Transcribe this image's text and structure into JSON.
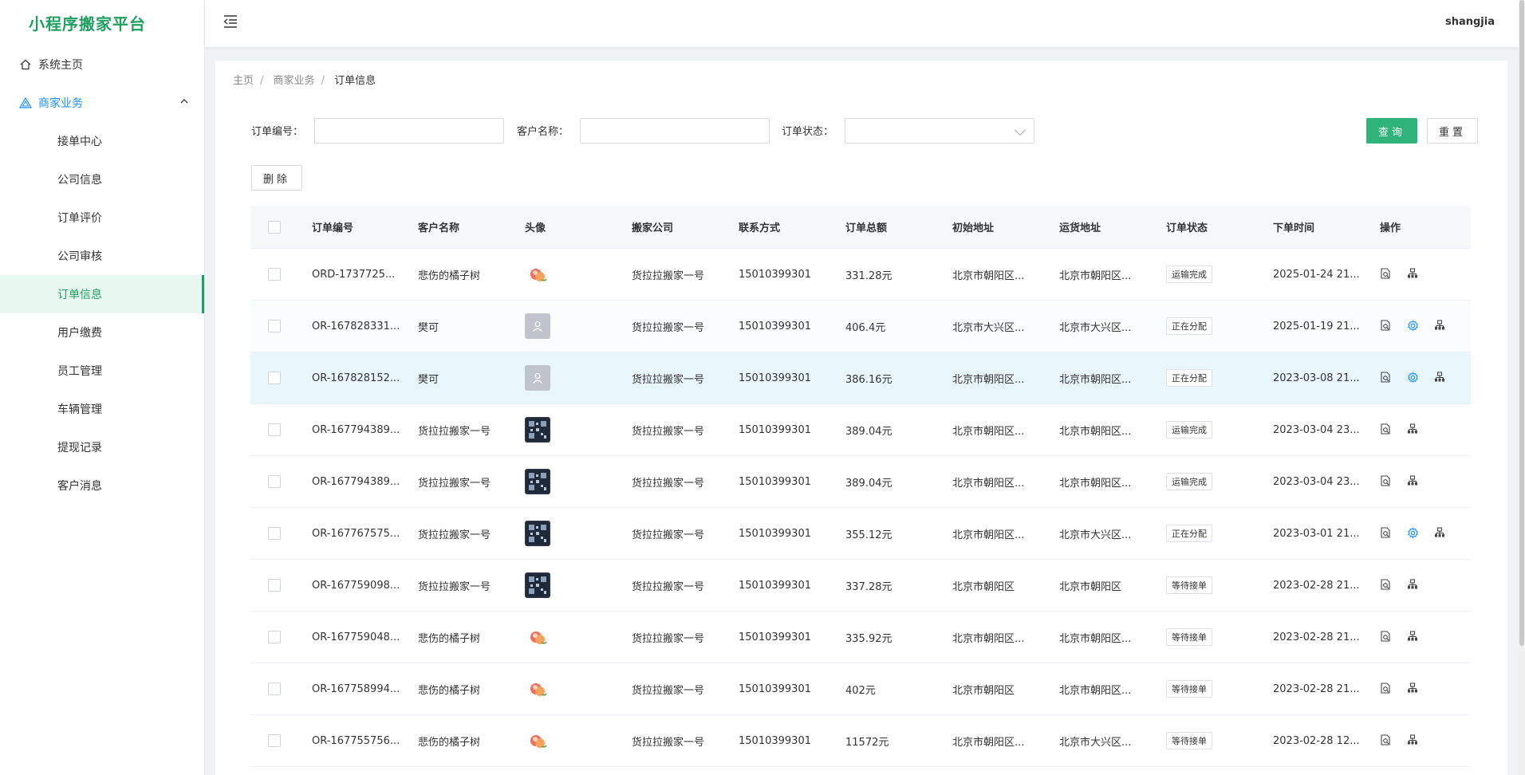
{
  "app": {
    "title": "小程序搬家平台"
  },
  "header": {
    "user": "shangjia"
  },
  "sidebar": {
    "home": {
      "label": "系统主页",
      "icon": "home-icon"
    },
    "group": {
      "label": "商家业务",
      "icon": "triangle-icon"
    },
    "items": [
      {
        "label": "接单中心",
        "active": false
      },
      {
        "label": "公司信息",
        "active": false
      },
      {
        "label": "订单评价",
        "active": false
      },
      {
        "label": "公司审核",
        "active": false
      },
      {
        "label": "订单信息",
        "active": true
      },
      {
        "label": "用户缴费",
        "active": false
      },
      {
        "label": "员工管理",
        "active": false
      },
      {
        "label": "车辆管理",
        "active": false
      },
      {
        "label": "提现记录",
        "active": false
      },
      {
        "label": "客户消息",
        "active": false
      }
    ]
  },
  "breadcrumb": [
    "主页",
    "商家业务",
    "订单信息"
  ],
  "filters": {
    "order_no_label": "订单编号：",
    "customer_label": "客户名称：",
    "status_label": "订单状态："
  },
  "buttons": {
    "query": "查询",
    "reset": "重置",
    "delete": "删除"
  },
  "table": {
    "columns": [
      "订单编号",
      "客户名称",
      "头像",
      "搬家公司",
      "联系方式",
      "订单总额",
      "初始地址",
      "运货地址",
      "订单状态",
      "下单时间",
      "操作"
    ],
    "rows": [
      {
        "order_no": "ORD-1737725...",
        "customer": "悲伤的橘子树",
        "avatar": "peach",
        "company": "货拉拉搬家一号",
        "phone": "15010399301",
        "amount": "331.28元",
        "from": "北京市朝阳区...",
        "to": "北京市朝阳区...",
        "status": "运输完成",
        "time": "2025-01-24 21...",
        "ops": [
          "view",
          "tree"
        ]
      },
      {
        "order_no": "OR-167828331...",
        "customer": "樊可",
        "avatar": "default",
        "company": "货拉拉搬家一号",
        "phone": "15010399301",
        "amount": "406.4元",
        "from": "北京市大兴区...",
        "to": "北京市大兴区...",
        "status": "正在分配",
        "time": "2025-01-19 21...",
        "ops": [
          "view",
          "gear",
          "tree"
        ]
      },
      {
        "order_no": "OR-167828152...",
        "customer": "樊可",
        "avatar": "default",
        "company": "货拉拉搬家一号",
        "phone": "15010399301",
        "amount": "386.16元",
        "from": "北京市朝阳区...",
        "to": "北京市朝阳区...",
        "status": "正在分配",
        "time": "2023-03-08 21...",
        "ops": [
          "view",
          "gear",
          "tree"
        ]
      },
      {
        "order_no": "OR-167794389...",
        "customer": "货拉拉搬家一号",
        "avatar": "qr",
        "company": "货拉拉搬家一号",
        "phone": "15010399301",
        "amount": "389.04元",
        "from": "北京市朝阳区...",
        "to": "北京市朝阳区...",
        "status": "运输完成",
        "time": "2023-03-04 23...",
        "ops": [
          "view",
          "tree"
        ]
      },
      {
        "order_no": "OR-167794389...",
        "customer": "货拉拉搬家一号",
        "avatar": "qr",
        "company": "货拉拉搬家一号",
        "phone": "15010399301",
        "amount": "389.04元",
        "from": "北京市朝阳区...",
        "to": "北京市朝阳区...",
        "status": "运输完成",
        "time": "2023-03-04 23...",
        "ops": [
          "view",
          "tree"
        ]
      },
      {
        "order_no": "OR-167767575...",
        "customer": "货拉拉搬家一号",
        "avatar": "qr",
        "company": "货拉拉搬家一号",
        "phone": "15010399301",
        "amount": "355.12元",
        "from": "北京市朝阳区...",
        "to": "北京市大兴区...",
        "status": "正在分配",
        "time": "2023-03-01 21...",
        "ops": [
          "view",
          "gear",
          "tree"
        ]
      },
      {
        "order_no": "OR-167759098...",
        "customer": "货拉拉搬家一号",
        "avatar": "qr",
        "company": "货拉拉搬家一号",
        "phone": "15010399301",
        "amount": "337.28元",
        "from": "北京市朝阳区",
        "to": "北京市朝阳区",
        "status": "等待接单",
        "time": "2023-02-28 21...",
        "ops": [
          "view",
          "tree"
        ]
      },
      {
        "order_no": "OR-167759048...",
        "customer": "悲伤的橘子树",
        "avatar": "peach",
        "company": "货拉拉搬家一号",
        "phone": "15010399301",
        "amount": "335.92元",
        "from": "北京市朝阳区...",
        "to": "北京市朝阳区...",
        "status": "等待接单",
        "time": "2023-02-28 21...",
        "ops": [
          "view",
          "tree"
        ]
      },
      {
        "order_no": "OR-167758994...",
        "customer": "悲伤的橘子树",
        "avatar": "peach",
        "company": "货拉拉搬家一号",
        "phone": "15010399301",
        "amount": "402元",
        "from": "北京市朝阳区",
        "to": "北京市朝阳区...",
        "status": "等待接单",
        "time": "2023-02-28 21...",
        "ops": [
          "view",
          "tree"
        ]
      },
      {
        "order_no": "OR-167755756...",
        "customer": "悲伤的橘子树",
        "avatar": "peach",
        "company": "货拉拉搬家一号",
        "phone": "15010399301",
        "amount": "11572元",
        "from": "北京市朝阳区...",
        "to": "北京市大兴区...",
        "status": "等待接单",
        "time": "2023-02-28 12...",
        "ops": [
          "view",
          "tree"
        ]
      }
    ]
  },
  "colors": {
    "brand": "#20a060",
    "primary_button": "#2fb37a",
    "link": "#1890ff",
    "gear": "#1890ff"
  }
}
